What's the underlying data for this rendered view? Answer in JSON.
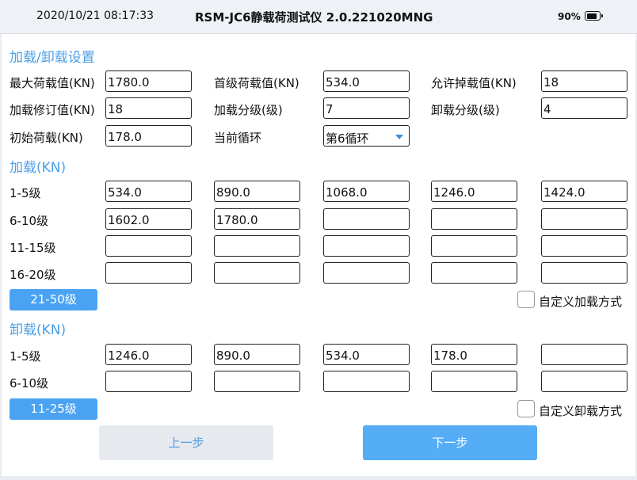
{
  "status": {
    "datetime": "2020/10/21 08:17:33",
    "app_title": "RSM-JC6静载荷测试仪 2.0.221020MNG",
    "battery": "90%",
    "battery_level": 0.9
  },
  "settings": {
    "section_title": "加载/卸载设置",
    "max_load_label": "最大荷载值(KN)",
    "max_load_value": "1780.0",
    "first_load_label": "首级荷载值(KN)",
    "first_load_value": "534.0",
    "allowed_drop_label": "允许掉载值(KN)",
    "allowed_drop_value": "18",
    "load_correction_label": "加载修订值(KN)",
    "load_correction_value": "18",
    "load_steps_label": "加载分级(级)",
    "load_steps_value": "7",
    "unload_steps_label": "卸载分级(级)",
    "unload_steps_value": "4",
    "initial_load_label": "初始荷载(KN)",
    "initial_load_value": "178.0",
    "current_cycle_label": "当前循环",
    "current_cycle_value": "第6循环"
  },
  "loading": {
    "section_title": "加载(KN)",
    "rows": [
      {
        "label": "1-5级",
        "values": [
          "534.0",
          "890.0",
          "1068.0",
          "1246.0",
          "1424.0"
        ]
      },
      {
        "label": "6-10级",
        "values": [
          "1602.0",
          "1780.0",
          "",
          "",
          ""
        ]
      },
      {
        "label": "11-15级",
        "values": [
          "",
          "",
          "",
          "",
          ""
        ]
      },
      {
        "label": "16-20级",
        "values": [
          "",
          "",
          "",
          "",
          ""
        ]
      }
    ],
    "more_button": "21-50级",
    "custom_label": "自定义加载方式"
  },
  "unloading": {
    "section_title": "卸载(KN)",
    "rows": [
      {
        "label": "1-5级",
        "values": [
          "1246.0",
          "890.0",
          "534.0",
          "178.0",
          ""
        ]
      },
      {
        "label": "6-10级",
        "values": [
          "",
          "",
          "",
          "",
          ""
        ]
      }
    ],
    "more_button": "11-25级",
    "custom_label": "自定义卸载方式"
  },
  "nav": {
    "prev_label": "上一步",
    "next_label": "下一步"
  }
}
